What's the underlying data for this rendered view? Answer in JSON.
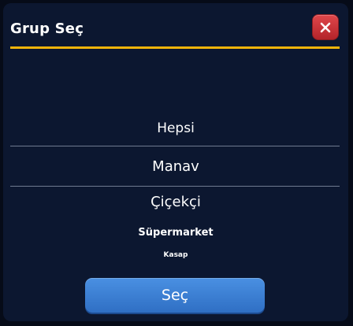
{
  "dialog": {
    "title": "Grup Seç",
    "close_icon": "close-x-icon",
    "accent_color": "#f2b40b",
    "close_color": "#d23a3f"
  },
  "picker": {
    "options": [
      "Hepsi",
      "Manav",
      "Çiçekçi",
      "Süpermarket",
      "Kasap"
    ],
    "selected": "Manav"
  },
  "footer": {
    "select_label": "Seç",
    "button_color": "#3d82d6"
  }
}
